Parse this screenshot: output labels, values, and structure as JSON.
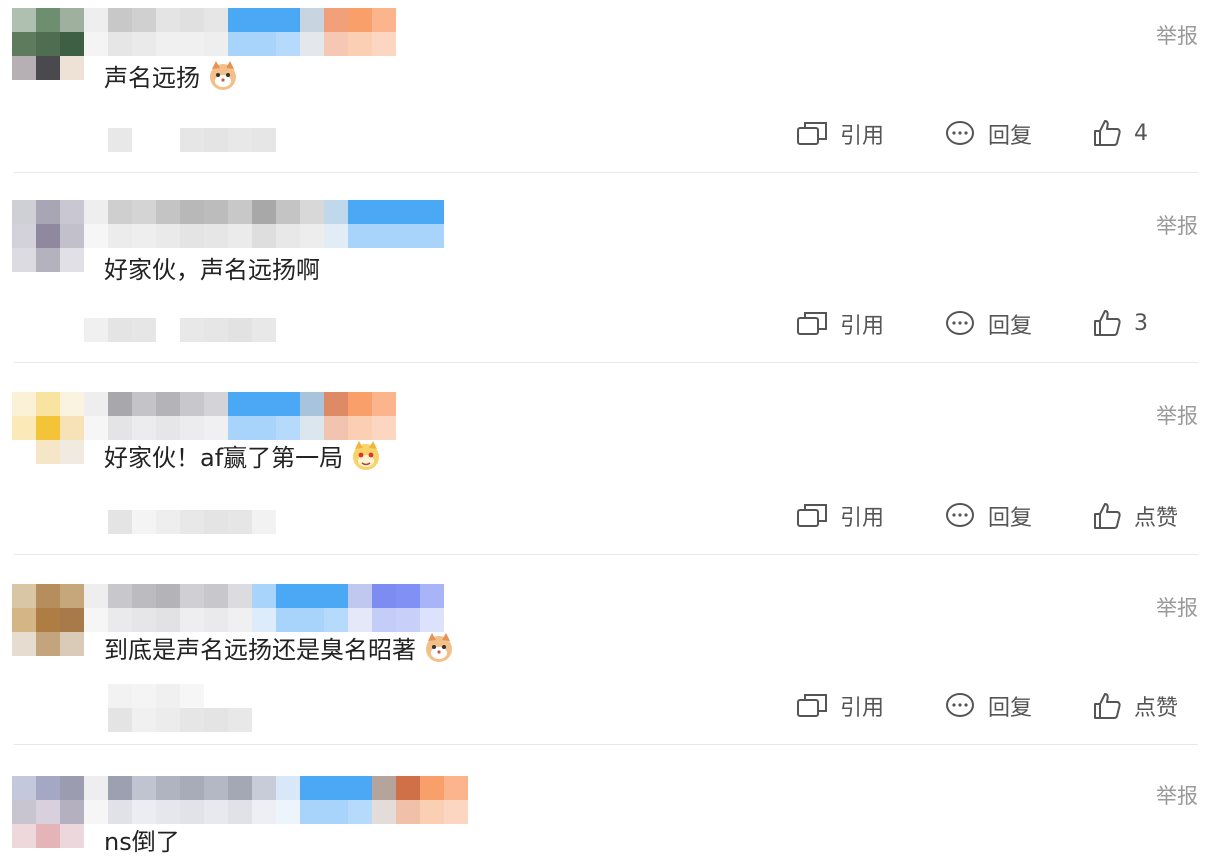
{
  "report_label": "举报",
  "actions": {
    "quote": "引用",
    "reply": "回复",
    "like": "点赞"
  },
  "comments": [
    {
      "text": "声名远扬",
      "emoji": "cat-emoji",
      "likes": "4"
    },
    {
      "text": "好家伙，声名远扬啊",
      "emoji": "",
      "likes": "3"
    },
    {
      "text": "好家伙！af赢了第一局",
      "emoji": "cat-emoji",
      "likes": "点赞"
    },
    {
      "text": "到底是声名远扬还是臭名昭著",
      "emoji": "cat-emoji",
      "likes": "点赞"
    },
    {
      "text": "ns倒了",
      "emoji": "",
      "likes": ""
    }
  ],
  "colors": {
    "blue": "#4aa8f5",
    "light_blue": "#a8d3fb",
    "orange": "#f89f6a",
    "gray": "#c9c9c9"
  }
}
